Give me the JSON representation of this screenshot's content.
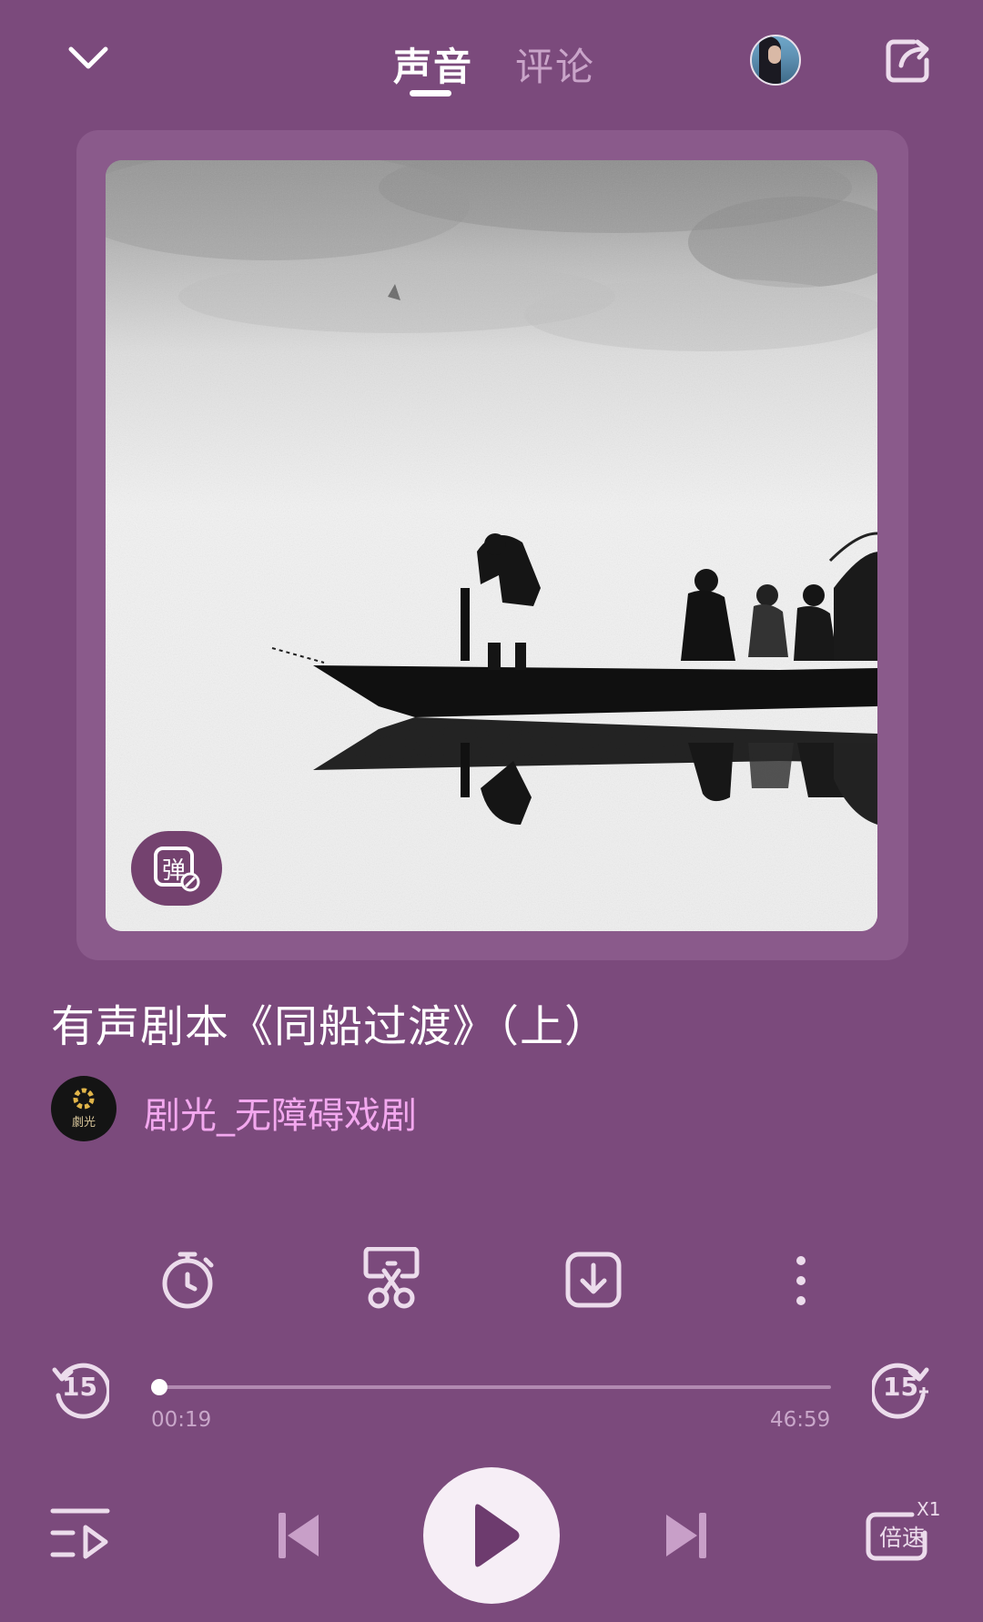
{
  "header": {
    "tabs": [
      {
        "label": "声音",
        "active": true
      },
      {
        "label": "评论",
        "active": false
      }
    ]
  },
  "cover": {
    "danmu_label": "弹"
  },
  "track": {
    "title": "有声剧本《同船过渡》（上）",
    "author_name": "剧光_无障碍戏剧",
    "author_logo_text": "劇光"
  },
  "player": {
    "elapsed": "00:19",
    "duration": "46:59",
    "progress": 0.0067,
    "rewind_label": "15",
    "forward_label": "15",
    "speed_label": "倍速",
    "speed_value": "X1"
  },
  "colors": {
    "background": "#7b4a7c",
    "author_name": "#f3a8ef",
    "play_button": "#f6eef6"
  }
}
